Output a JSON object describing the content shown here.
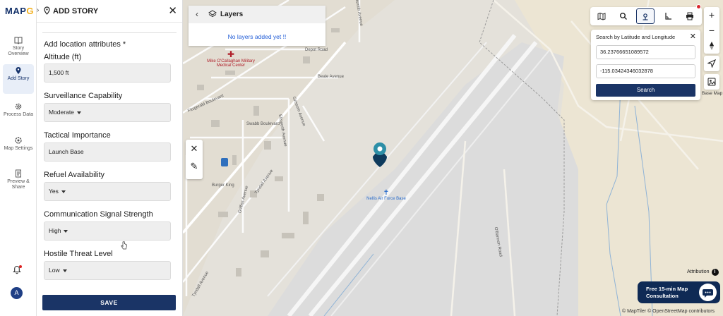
{
  "app": {
    "logo_prefix": "MAP",
    "logo_suffix": "G"
  },
  "rail": {
    "items": [
      {
        "label": "Story Overview",
        "icon": "book-icon"
      },
      {
        "label": "Add Story",
        "icon": "location-pin-icon"
      },
      {
        "label": "Process Data",
        "icon": "gear-icon"
      },
      {
        "label": "Map Settings",
        "icon": "settings-icon"
      },
      {
        "label": "Preview & Share",
        "icon": "document-icon"
      }
    ],
    "avatar_initial": "A"
  },
  "panel": {
    "title": "ADD STORY",
    "section_title": "Add location attributes *",
    "fields": [
      {
        "label": "Altitude (ft)",
        "value": "1,500 ft",
        "dropdown": false
      },
      {
        "label": "Surveillance Capability",
        "value": "Moderate",
        "dropdown": true
      },
      {
        "label": "Tactical Importance",
        "value": "Launch Base",
        "dropdown": false
      },
      {
        "label": "Refuel Availability",
        "value": "Yes",
        "dropdown": true
      },
      {
        "label": "Communication Signal Strength",
        "value": "High",
        "dropdown": true
      },
      {
        "label": "Hostile Threat Level",
        "value": "Low",
        "dropdown": true
      }
    ],
    "save_label": "SAVE"
  },
  "layers": {
    "title": "Layers",
    "empty_text": "No layers added yet !!"
  },
  "search": {
    "title": "Search by Latitude and Longitude",
    "latitude": "36.23766651089572",
    "longitude": "-115.03424346032878",
    "button": "Search"
  },
  "controls": {
    "zoom_in": "+",
    "zoom_out": "−",
    "base_map_label": "Base Map"
  },
  "map": {
    "labels": {
      "wurtsmith": "Wurtsmith Avenue",
      "depot": "Depot Road",
      "beale": "Beale Avenue",
      "fitzgerald": "Fitzgerald Boulevard",
      "swabb": "Swabb Boulevard",
      "ellsworth": "Ellsworth Avenue",
      "griffiss": "Griffiss Avenue",
      "tyndall": "Tyndall Avenue",
      "tyndall2": "Tyndall Avenue",
      "burger_king": "Burger King",
      "hospital": "Mike O'Callaghan Military Medical Center",
      "nellis": "Nellis Air Force Base",
      "obannon": "O'Bannon Road",
      "grissom": "Grissom Avenue"
    },
    "attribution": "Attribution",
    "credit": "© MapTiler © OpenStreetMap contributors"
  },
  "consult": {
    "text": "Free 15-min Map Consultation"
  },
  "colors": {
    "navy": "#1a3466",
    "marker": "#0e3a5c",
    "marker_top": "#2d8fa7",
    "notification": "#d9262c"
  }
}
